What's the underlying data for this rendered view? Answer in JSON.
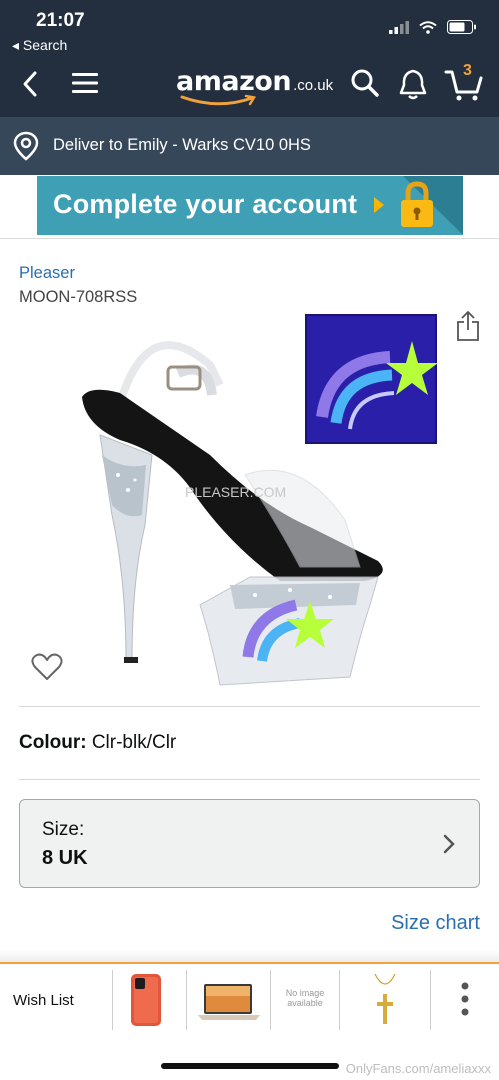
{
  "status": {
    "time": "21:07",
    "back_app": "◂ Search"
  },
  "header": {
    "logo_word": "amazon",
    "logo_tld": ".co.uk",
    "cart_count": "3"
  },
  "deliver": {
    "text": "Deliver to Emily - Warks CV10 0HS"
  },
  "banner": {
    "text": "Complete your account"
  },
  "product": {
    "brand": "Pleaser",
    "model": "MOON-708RSS",
    "image_watermark": "PLEASER.COM"
  },
  "colour": {
    "label": "Colour:",
    "value": "Clr-blk/Clr"
  },
  "size": {
    "label": "Size:",
    "value": "8 UK"
  },
  "size_chart": "Size chart",
  "tray": {
    "wish_list": "Wish List",
    "no_image_line1": "No image",
    "no_image_line2": "available"
  },
  "watermark": "OnlyFans.com/ameliaxxx",
  "colors": {
    "header_bg": "#232f3e",
    "deliver_bg": "#37475a",
    "banner_bg": "#3f9fb4",
    "link": "#2a6fb0",
    "accent": "#f0a23c"
  }
}
